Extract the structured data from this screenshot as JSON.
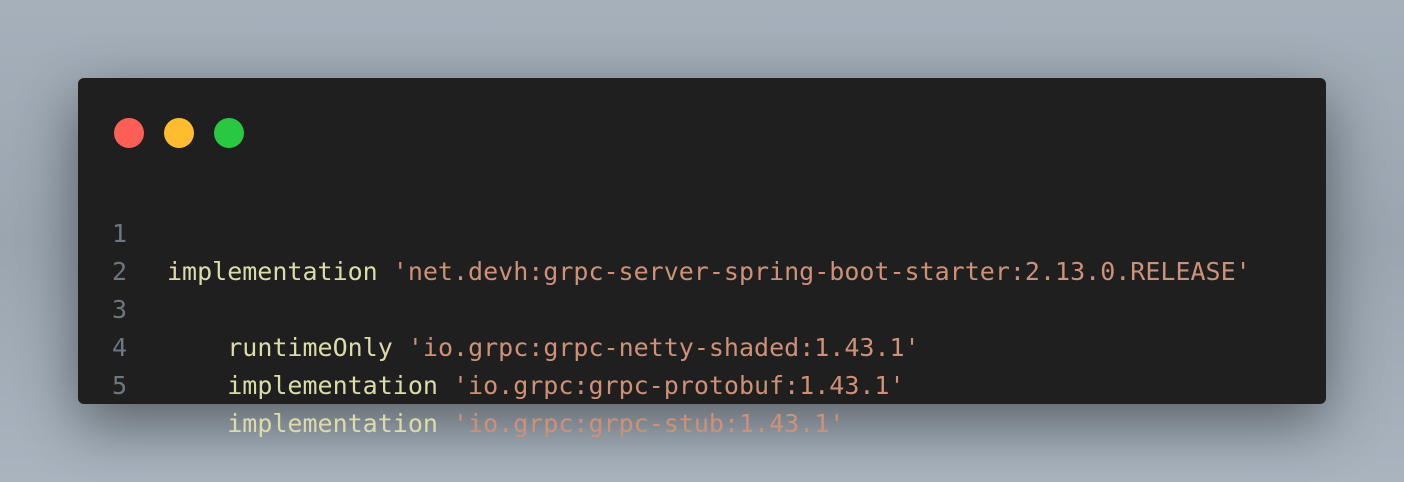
{
  "window_controls": {
    "close_color": "#ff5f57",
    "minimize_color": "#febc2e",
    "maximize_color": "#28c840"
  },
  "lines": [
    {
      "number": "1",
      "indent": "",
      "keyword": "implementation",
      "string": "'net.devh:grpc-server-spring-boot-starter:2.13.0.RELEASE'"
    },
    {
      "number": "2",
      "indent": "",
      "keyword": "",
      "string": ""
    },
    {
      "number": "3",
      "indent": "    ",
      "keyword": "runtimeOnly",
      "string": "'io.grpc:grpc-netty-shaded:1.43.1'"
    },
    {
      "number": "4",
      "indent": "    ",
      "keyword": "implementation",
      "string": "'io.grpc:grpc-protobuf:1.43.1'"
    },
    {
      "number": "5",
      "indent": "    ",
      "keyword": "implementation",
      "string": "'io.grpc:grpc-stub:1.43.1'"
    }
  ]
}
